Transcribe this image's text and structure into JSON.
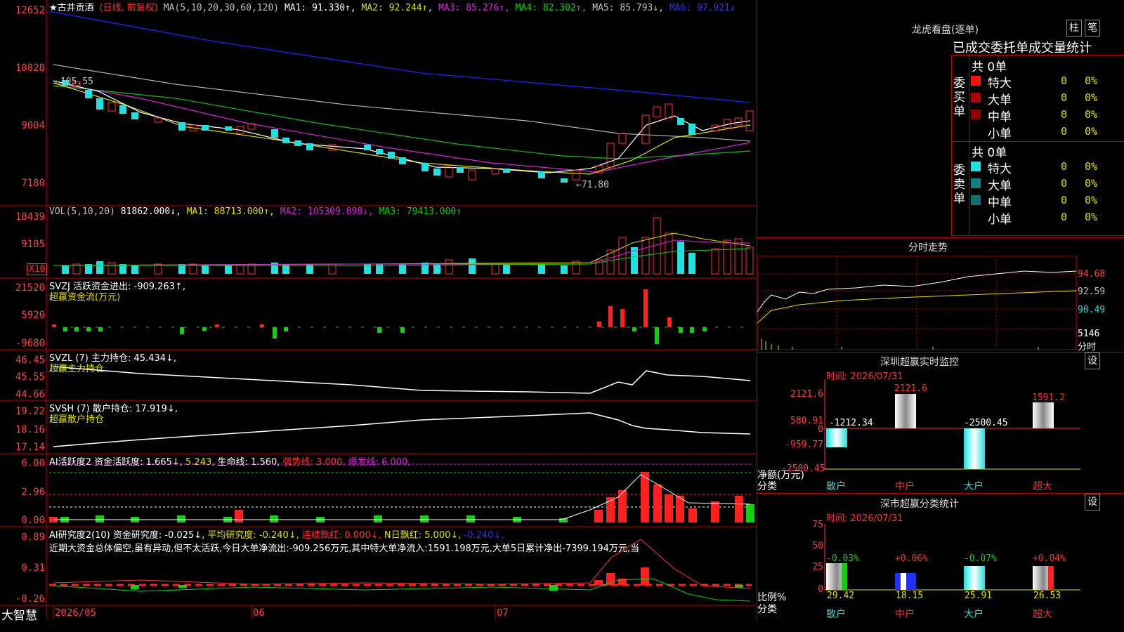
{
  "header": {
    "stock": "★古井贡酒",
    "mode": "(日线, 前复权)",
    "ma_label": "MA(5,10,20,30,60,120)",
    "ma1": "MA1: 91.330↑,",
    "ma2": "MA2: 92.244↑,",
    "ma3": "MA3: 85.276↑,",
    "ma4": "MA4: 82.302↑,",
    "ma5": "MA5: 85.793↓,",
    "ma6": "MA6: 97.921↓"
  },
  "price_axis": [
    "12652",
    "10828",
    "9004",
    "7180"
  ],
  "price_marks": {
    "high": "←105.55",
    "low": "←71.80"
  },
  "vol": {
    "label": "VOL(5,10,20)",
    "value": "81862.000↓,",
    "ma1": "MA1: 88713.000↑,",
    "ma2": "MA2: 105309.898↓,",
    "ma3": "MA3: 79413.000↑",
    "axis": [
      "18439",
      "9105"
    ],
    "unit": "X10"
  },
  "svzj": {
    "label": "SVZJ  活跃资金进出: -909.263↑,",
    "sub": "超赢资金流(万元)",
    "axis": [
      "21520",
      "5920",
      "-9680"
    ]
  },
  "svzl": {
    "label": "SVZL (7) 主力持仓: 45.434↓,",
    "sub": "超赢主力持仓",
    "axis": [
      "46.45",
      "45.55",
      "44.66"
    ]
  },
  "svsh": {
    "label": "SVSH (7) 散户持仓: 17.919↓,",
    "sub": "超赢散户持仓",
    "axis": [
      "19.22",
      "18.16",
      "17.14"
    ]
  },
  "ai_active": {
    "label": "AI活跃度2 资金活跃度: 1.665↓,",
    "v2": "5.243,",
    "life": "生命线: 1.560,",
    "strong": "强势线: 3.000,",
    "burst": "爆发线: 6.000,",
    "axis": [
      "6.00",
      "2.96",
      "0.00"
    ]
  },
  "ai_research": {
    "label": "AI研究度2(10) 资金研究度: -0.025↓,",
    "avg": "平均研究度: -0.240↓,",
    "cont": "连续飘红: 0.000↓,",
    "nday": "N日飘红: 5.000↓,",
    "last": "-0.240↓,",
    "text": "近期大资金总体偏空,虽有异动,但不太活跃,今日大单净流出:-909.256万元,其中特大单净流入:1591.198万元,大单5日累计净出-7399.194万元,当",
    "axis": [
      "0.89",
      "0.31",
      "-0.26"
    ]
  },
  "bottom": {
    "brand": "大智慧",
    "dates": [
      "2026/05",
      "06",
      "07"
    ]
  },
  "right": {
    "lhb_title": "龙虎看盘(逐单)",
    "btn_zhu": "柱",
    "btn_bi": "笔",
    "col_header": "已成交委托单成交量统计",
    "buy_label": "委买单",
    "sell_label": "委卖单",
    "buy_total": "共 0单",
    "sell_total": "共 0单",
    "rows": [
      {
        "name": "特大",
        "count": "0",
        "pct": "0%"
      },
      {
        "name": "大单",
        "count": "0",
        "pct": "0%"
      },
      {
        "name": "中单",
        "count": "0",
        "pct": "0%"
      },
      {
        "name": "小单",
        "count": "0",
        "pct": "0%"
      }
    ],
    "intraday_title": "分时走势",
    "intraday_axis": [
      "94.68",
      "92.59",
      "90.49",
      "5146"
    ],
    "intraday_unit": "分时",
    "mon_title": "深圳超赢实时监控",
    "mon_time": "时间: 2026/07/31",
    "mon_axis": [
      "2121.6",
      "580.91",
      "0",
      "-959.77",
      "-2500.45"
    ],
    "mon_values": [
      "-1212.34",
      "2121.6",
      "-2500.45",
      "1591.2"
    ],
    "mon_net": "净额(万元)",
    "mon_cat": "分类",
    "cats": [
      "散户",
      "中户",
      "大户",
      "超大"
    ],
    "stat_title": "深市超赢分类统计",
    "stat_time": "时间: 2026/07/31",
    "stat_axis": [
      "75",
      "50",
      "25",
      "0"
    ],
    "stat_deltas": [
      "-0.03%",
      "+0.06%",
      "-0.07%",
      "+0.04%"
    ],
    "stat_values": [
      "29.42",
      "18.15",
      "25.91",
      "26.53"
    ],
    "stat_ratio": "比例%",
    "stat_cat": "分类",
    "set": "设"
  }
}
